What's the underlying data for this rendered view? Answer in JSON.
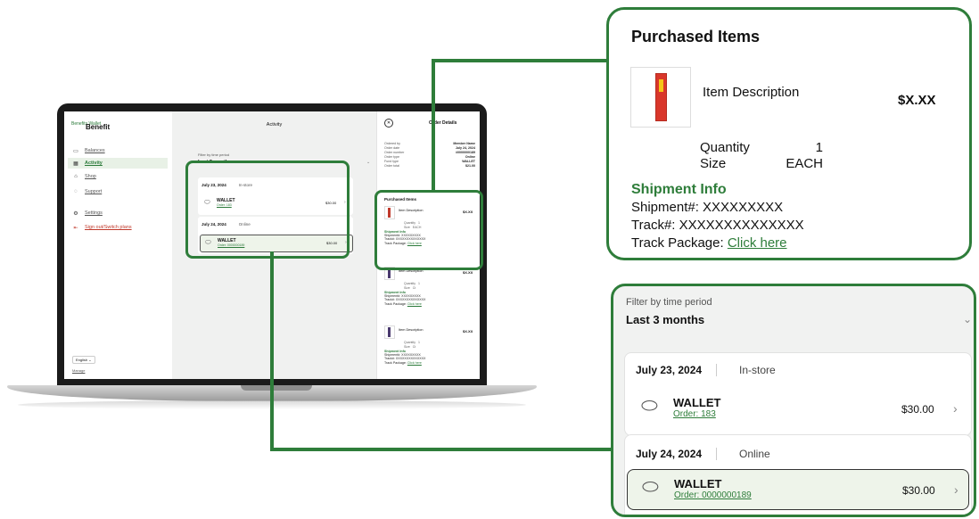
{
  "sidebar": {
    "logo_text": "Benefits Wallet",
    "brand": "Benefit",
    "items": [
      {
        "icon": "wallet-icon",
        "glyph": "▭",
        "label": "Balances"
      },
      {
        "icon": "activity-icon",
        "glyph": "▦",
        "label": "Activity"
      },
      {
        "icon": "shop-icon",
        "glyph": "⌂",
        "label": "Shop"
      },
      {
        "icon": "support-icon",
        "glyph": "◌",
        "label": "Support"
      },
      {
        "icon": "settings-icon",
        "glyph": "⚙",
        "label": "Settings"
      },
      {
        "icon": "signout-icon",
        "glyph": "⇤",
        "label": "Sign out/Switch plans"
      }
    ],
    "language": "English  ⌄",
    "manage": "Manage"
  },
  "main": {
    "title": "Activity",
    "filter_label": "Filter by time period",
    "filter_value": "Last 3 months",
    "groups": [
      {
        "date": "July 23, 2024",
        "channel": "In-store",
        "item": "WALLET",
        "order": "Order: 183",
        "amount": "$30.00"
      },
      {
        "date": "July 24, 2024",
        "channel": "Online",
        "item": "WALLET",
        "order": "Order: 0000000189",
        "amount": "$30.00"
      }
    ]
  },
  "order_details": {
    "title": "Order Details",
    "fields": [
      {
        "k": "Ordered by",
        "v": "Member Name"
      },
      {
        "k": "Order date",
        "v": "July 24, 2024"
      },
      {
        "k": "Order number",
        "v": "#0000000189"
      },
      {
        "k": "Order type",
        "v": "Online"
      },
      {
        "k": "Fund type",
        "v": "WALLET"
      },
      {
        "k": "Order total",
        "v": "$21.00"
      }
    ],
    "purchased_title": "Purchased Items",
    "item_desc": "Item Description",
    "price": "$X.XX",
    "qty_label": "Quantity",
    "qty_value": "1",
    "size_label": "Size",
    "size_value": "EACH",
    "ship_title": "Shipment Info",
    "shipment": "Shipment#: XXXXXXXXX",
    "track": "Track#: XXXXXXXXXXXXXX",
    "track_pkg_label": "Track Package: ",
    "track_pkg_link": "Click here",
    "short_size": "Ct"
  },
  "colors": {
    "accent": "#2e7d3a",
    "link": "#2b7a3a"
  }
}
